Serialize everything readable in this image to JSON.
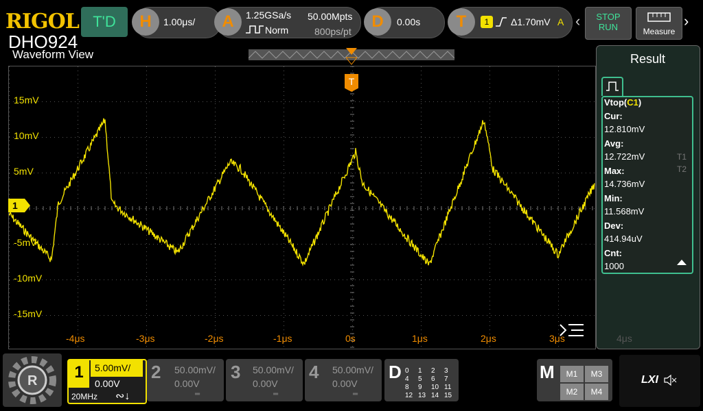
{
  "brand": "RIGOL",
  "model": "DHO924",
  "topbar": {
    "td_label": "T'D",
    "h_label": "H",
    "h_value": "1.00μs/",
    "a_label": "A",
    "a_rate": "1.25GSa/s",
    "a_mpts": "50.00Mpts",
    "a_mode": "Norm",
    "a_ps": "800ps/pt",
    "d_label": "D",
    "d_value": "0.00s",
    "t_label": "T",
    "t_channel": "1",
    "t_value": "Δ1.70mV",
    "t_mode": "A",
    "stop": "STOP",
    "run": "RUN",
    "measure": "Measure"
  },
  "waveform": {
    "title": "Waveform View",
    "trigger_marker": "T",
    "channel_marker": "1",
    "y_labels": [
      "15mV",
      "10mV",
      "5mV",
      "-5mV",
      "-10mV",
      "-15mV"
    ],
    "x_labels": [
      "-4μs",
      "-3μs",
      "-2μs",
      "-1μs",
      "0s",
      "1μs",
      "2μs",
      "3μs",
      "4μs"
    ]
  },
  "result": {
    "title": "Result",
    "measure_name": "Vtop(",
    "measure_ch": "C1",
    "measure_close": ")",
    "rows": [
      {
        "label": "Cur:",
        "value": "12.810mV"
      },
      {
        "label": "Avg:",
        "value": "12.722mV"
      },
      {
        "label": "Max:",
        "value": "14.736mV"
      },
      {
        "label": "Min:",
        "value": "11.568mV"
      },
      {
        "label": "Dev:",
        "value": "414.94uV"
      },
      {
        "label": "Cnt:",
        "value": "1000"
      }
    ],
    "side_tags": [
      "T1",
      "T2"
    ]
  },
  "channels": [
    {
      "num": "1",
      "scale": "5.00mV/",
      "offset": "0.00V",
      "bw": "20MHz",
      "active": true
    },
    {
      "num": "2",
      "scale": "50.00mV/",
      "offset": "0.00V",
      "active": false
    },
    {
      "num": "3",
      "scale": "50.00mV/",
      "offset": "0.00V",
      "active": false
    },
    {
      "num": "4",
      "scale": "50.00mV/",
      "offset": "0.00V",
      "active": false
    }
  ],
  "digital": {
    "label": "D",
    "grid": [
      "0",
      "1",
      "2",
      "3",
      "4",
      "5",
      "6",
      "7",
      "8",
      "9",
      "10",
      "11",
      "12",
      "13",
      "14",
      "15"
    ]
  },
  "math": {
    "label": "M",
    "buttons": [
      "M1",
      "M3",
      "M2",
      "M4"
    ]
  },
  "lxi": "LXI",
  "colors": {
    "ch1": "#f2e100",
    "trigger": "#f08c00",
    "panel_border": "#3fbf8f"
  }
}
